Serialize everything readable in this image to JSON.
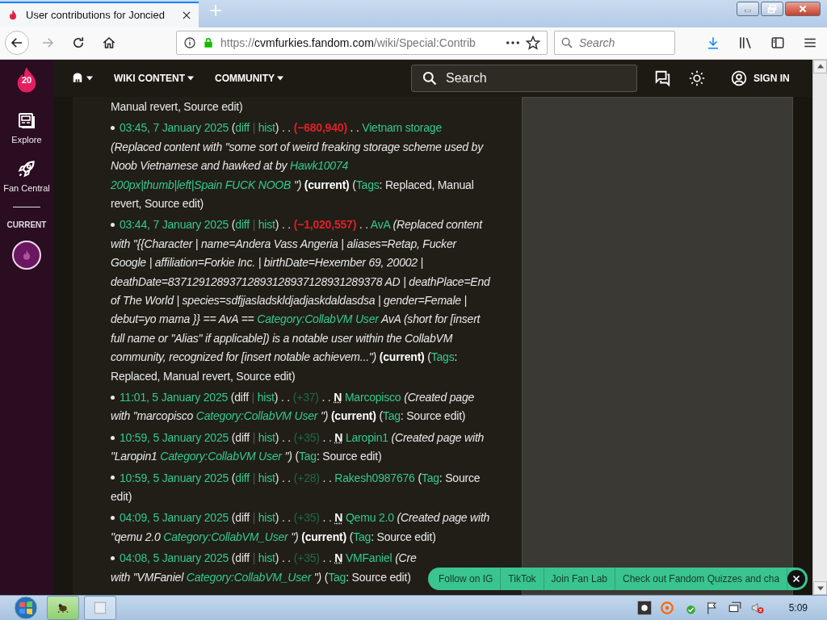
{
  "browser": {
    "tab_title": "User contributions for Joncied",
    "url_scheme": "https://",
    "url_host": "cvmfurkies.fandom.com",
    "url_path": "/wiki/Special:Contrib",
    "search_placeholder": "Search"
  },
  "fandom": {
    "logo_text": "20",
    "sidebar": [
      {
        "kind": "explore",
        "label": "Explore"
      },
      {
        "kind": "fan-central",
        "label": "Fan Central"
      }
    ],
    "current_label": "CURRENT",
    "nav": [
      "WIKI CONTENT",
      "COMMUNITY"
    ],
    "search_label": "Search",
    "sign_in": "SIGN IN"
  },
  "punctuation": {
    "open": "(",
    "close": ")",
    "pipe": "|",
    "dots": ". ."
  },
  "contributions": [
    {
      "kind": "partial",
      "text": "Manual revert, Source edit)"
    },
    {
      "kind": "entry",
      "time": "03:45, 7 January 2025",
      "diff": "diff",
      "diff_link": true,
      "hist": "hist",
      "size": {
        "text": "(−680,940)",
        "color": "#e0202a"
      },
      "page": "Vietnam storage",
      "summary": [
        {
          "kind": "text",
          "text": "(Replaced content with \"some sort of weird freaking storage scheme used by Noob Vietnamese and hawked at by "
        },
        {
          "kind": "link",
          "text": "Hawk10074"
        },
        {
          "kind": "link",
          "text": "200px|thumb|left|Spain FUCK NOOB"
        },
        {
          "kind": "text",
          "text": "\")"
        }
      ],
      "current": "(current)",
      "tags_label": "Tags",
      "tags": ": Replaced, Manual revert, Source edit)"
    },
    {
      "kind": "entry",
      "time": "03:44, 7 January 2025",
      "diff": "diff",
      "diff_link": true,
      "hist": "hist",
      "size": {
        "text": "(−1,020,557)",
        "color": "#e0202a"
      },
      "page": "AvA",
      "summary": [
        {
          "kind": "text",
          "text": "(Replaced content with \"{{Character | name=Andera Vass Angeria | aliases=Retap, Fucker Google | affiliation=Forkie Inc. | birthDate=Hexember 69, 20002 | deathDate=83712912893712893128937128931289378 AD | deathPlace=End of The World | species=sdfjjasladskldjadjaskdaldasdsa | gender=Female | debut=yo mama }} == AvA == "
        },
        {
          "kind": "link",
          "text": "Category:CollabVM User"
        },
        {
          "kind": "text",
          "text": " AvA (short for [insert full name or \"Alias\" if applicable]) is a notable user within the CollabVM community, recognized for [insert notable achievem...\")"
        }
      ],
      "current": "(current)",
      "tags_label": "Tags",
      "tags": ": Replaced, Manual revert, Source edit)"
    },
    {
      "kind": "entry",
      "time": "11:01, 5 January 2025",
      "diff": "diff",
      "diff_link": false,
      "hist": "hist",
      "size": {
        "text": "(+37)",
        "color": "#1f6a45"
      },
      "flag": "N",
      "page": "Marcopisco",
      "summary": [
        {
          "kind": "text",
          "text": "(Created page with \"marcopisco "
        },
        {
          "kind": "link",
          "text": "Category:CollabVM User"
        },
        {
          "kind": "text",
          "text": "\")"
        }
      ],
      "current": "(current)",
      "tags_label": "Tag",
      "tags": ": Source edit)"
    },
    {
      "kind": "entry",
      "time": "10:59, 5 January 2025",
      "diff": "diff",
      "diff_link": false,
      "hist": "hist",
      "size": {
        "text": "(+35)",
        "color": "#1f6a45"
      },
      "flag": "N",
      "page": "Laropin1",
      "summary": [
        {
          "kind": "text",
          "text": "(Created page with \"Laropin1 "
        },
        {
          "kind": "link",
          "text": "Category:CollabVM User"
        },
        {
          "kind": "text",
          "text": "\")"
        }
      ],
      "tags_label": "Tag",
      "tags": ": Source edit)"
    },
    {
      "kind": "entry",
      "time": "10:59, 5 January 2025",
      "diff": "diff",
      "diff_link": true,
      "hist": "hist",
      "size": {
        "text": "(+28)",
        "color": "#1f6a45"
      },
      "page": "Rakesh0987676",
      "tags_label": "Tag",
      "tags": ": Source edit)"
    },
    {
      "kind": "entry",
      "time": "04:09, 5 January 2025",
      "diff": "diff",
      "diff_link": false,
      "hist": "hist",
      "size": {
        "text": "(+35)",
        "color": "#1f6a45"
      },
      "flag": "N",
      "page": "Qemu 2.0",
      "summary": [
        {
          "kind": "text",
          "text": "(Created page with \"qemu 2.0 "
        },
        {
          "kind": "link",
          "text": "Category:CollabVM_User"
        },
        {
          "kind": "text",
          "text": "\")"
        }
      ],
      "current": "(current)",
      "tags_label": "Tag",
      "tags": ": Source edit)"
    },
    {
      "kind": "entry",
      "time": "04:08, 5 January 2025",
      "diff": "diff",
      "diff_link": false,
      "hist": "hist",
      "size": {
        "text": "(+35)",
        "color": "#1f6a45"
      },
      "flag": "N",
      "page": "VMFaniel",
      "summary": [
        {
          "kind": "text",
          "text": "(Cre"
        },
        {
          "kind": "break"
        },
        {
          "kind": "text",
          "text": "with \"VMFaniel "
        },
        {
          "kind": "link",
          "text": "Category:CollabVM_User"
        },
        {
          "kind": "text",
          "text": "\")"
        }
      ],
      "tags_label": "Tag",
      "tags": ": Source edit)"
    }
  ],
  "promo_bar": {
    "items": [
      "Follow on IG",
      "TikTok",
      "Join Fan Lab",
      "Check out Fandom Quizzes and cha"
    ]
  },
  "taskbar": {
    "clock": "5:09"
  }
}
